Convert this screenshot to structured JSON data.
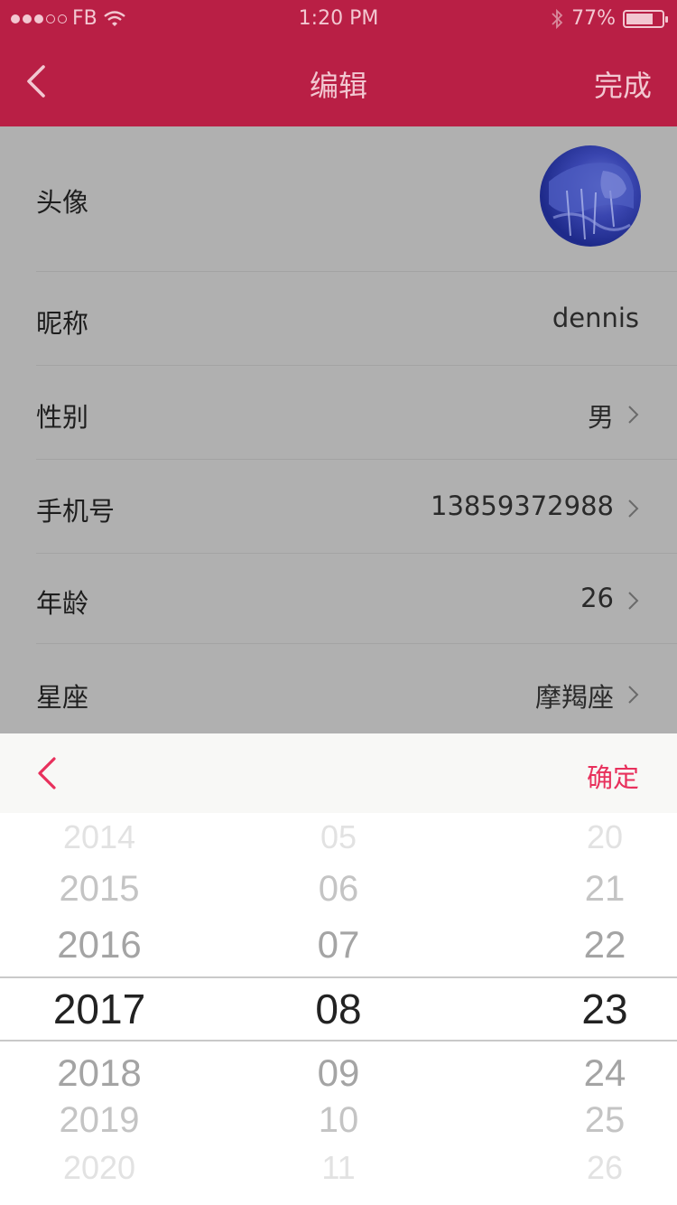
{
  "status_bar": {
    "carrier": "FB",
    "time": "1:20 PM",
    "battery": "77%",
    "battery_level": 0.77,
    "signal_dots_filled": 3,
    "signal_dots_total": 5,
    "icons": [
      "wifi-icon",
      "bluetooth-icon",
      "battery-icon"
    ]
  },
  "nav": {
    "title": "编辑",
    "done_label": "完成",
    "back_icon": "chevron-left-icon"
  },
  "form": {
    "avatar_label": "头像",
    "nickname_label": "昵称",
    "nickname_value": "dennis",
    "gender_label": "性别",
    "gender_value": "男",
    "phone_label": "手机号",
    "phone_value": "13859372988",
    "age_label": "年龄",
    "age_value": "26",
    "constellation_label": "星座",
    "constellation_value": "摩羯座"
  },
  "picker": {
    "ok_label": "确定",
    "back_icon": "chevron-left-icon",
    "years": [
      "2014",
      "2015",
      "2016",
      "2017",
      "2018",
      "2019",
      "2020"
    ],
    "months": [
      "05",
      "06",
      "07",
      "08",
      "09",
      "10",
      "11"
    ],
    "days": [
      "20",
      "21",
      "22",
      "23",
      "24",
      "25",
      "26"
    ],
    "selected_index": 3
  },
  "colors": {
    "brand": "#b91f45",
    "accent": "#e8305c"
  }
}
